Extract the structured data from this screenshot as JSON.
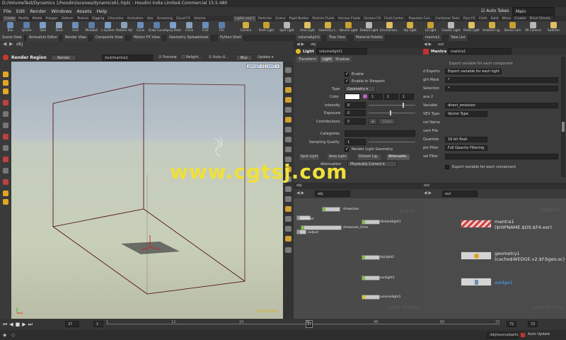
{
  "window": {
    "title": "D:/VolumeTest/Dynamics 1/houdini/scenes/dynamics61.hiplc - Houdini Indie Limited-Commercial 15.5.480"
  },
  "menu": [
    "File",
    "Edit",
    "Render",
    "Windows",
    "Assets",
    "Help"
  ],
  "workspace": {
    "auto_takes": "Auto Takes",
    "desktop": "Main"
  },
  "shelf_tabs_left": [
    "Create",
    "Modify",
    "Model",
    "Polygon",
    "Deform",
    "Texture",
    "Rigging",
    "Character",
    "Animation",
    "Hair",
    "Grooming",
    "Cloud FX",
    "Volume"
  ],
  "shelf_tabs_right": [
    "Lights and C",
    "Particles",
    "Grains",
    "Rigid Bodies",
    "Particle Fluids",
    "Viscous Fluids",
    "Oceans FX",
    "Fluid Contai..",
    "Populate Con..",
    "Container Tools",
    "Pyro FX",
    "Cloth",
    "Solid",
    "Wires",
    "Crowds",
    "Drive Simula.."
  ],
  "shelf_tools_left": [
    "Box",
    "Sphere",
    "Tube",
    "Torus",
    "Grid",
    "Metaball",
    "L-System",
    "Platonic Sol..",
    "Curve",
    "Draw Curve",
    "Spray Paint",
    "Circle",
    "Font",
    "File"
  ],
  "shelf_tools_right": [
    "Camera",
    "Point Light",
    "Spot Light",
    "Area Light",
    "Geometry L..",
    "Volume Light",
    "Distant Light",
    "Environmen..",
    "Sky Light",
    "GI Light",
    "Caustic Light",
    "Portal Light",
    "Ambient Lig..",
    "Stereo Cam",
    "VR Camera",
    "Switcher"
  ],
  "pane_tabs": [
    "Scene View",
    "Animation Editor",
    "Render View",
    "Composite View",
    "Motion FX View",
    "Geometry Spreadsheet",
    "Python Shell",
    "volumelight1",
    "Tree View",
    "Material Palette",
    "mantra1",
    "Take List"
  ],
  "viewport": {
    "title": "Render Region",
    "render_btn": "Render",
    "path": "/out/mantra1",
    "preview": "Preview",
    "relight": "Relight...",
    "auto_update": "Auto-U...",
    "blur": "Blur",
    "update": "Update",
    "obj": "obj",
    "persp": "persp1 ▾",
    "cam": "cam1 ▾",
    "edition": "Indie Edition"
  },
  "light": {
    "type_label": "Light",
    "name": "volumelight1",
    "tabs": [
      "Transform",
      "Light",
      "Shadow"
    ],
    "enable": "Enable",
    "enable_viewport": "Enable In Viewport",
    "type": "Type",
    "type_value": "Geometry",
    "color": "Color",
    "color_vals": [
      "1",
      "1",
      "1"
    ],
    "intensity": "Intensity",
    "intensity_val": "8",
    "exposure": "Exposure",
    "exposure_val": "0",
    "contributions": "Contributions",
    "contributions_val": "0",
    "clear": "Clear",
    "categories": "Categories",
    "sampling": "Sampling Quality",
    "sampling_val": "1",
    "render_geo": "Render Light Geometry",
    "subtabs": [
      "Spot Light",
      "Area Light",
      "Distant Lig..",
      "Attenuatio.."
    ],
    "attenuation": "Attenuation",
    "physically": "Physically Correct"
  },
  "mantra": {
    "label": "Mantra",
    "name": "mantra1",
    "header_note": "Export variable for each component",
    "rows": [
      {
        "label": "d Exports",
        "value": "Export variable for each light"
      },
      {
        "label": "ght Mask",
        "value": "*"
      },
      {
        "label": "Selection",
        "value": "*"
      },
      {
        "label": "ane 2",
        "value": ""
      },
      {
        "label": "Variable",
        "value": "direct_emission"
      },
      {
        "label": "VEX Type",
        "value": "Vector Type"
      },
      {
        "label": "nel Name",
        "value": ""
      },
      {
        "label": "vent File",
        "value": ""
      },
      {
        "label": "Quantize",
        "value": "16 bit float"
      },
      {
        "label": "ple Filter",
        "value": "Full Opacity Filtering"
      },
      {
        "label": "xel Filter",
        "value": ""
      }
    ],
    "footer_note": "Export variable for each component"
  },
  "netA": {
    "path": "obj",
    "context": "Scene",
    "edition": "Indie Edition",
    "nodes": [
      {
        "name": "showcase"
      },
      {
        "name": "skyrloder"
      },
      {
        "name": "dilstantlight1"
      },
      {
        "name": "showcase_hires"
      },
      {
        "name": "output"
      },
      {
        "name": "skylight1"
      },
      {
        "name": "sunlight1"
      },
      {
        "name": "volumelight1"
      }
    ]
  },
  "netB": {
    "path": "out",
    "context": "Outputs",
    "edition": "Indie Edition",
    "nodes": [
      {
        "name": "mantra1",
        "sub": "($HIPNAME.$OS.$F4.exr)"
      },
      {
        "name": "geometry1",
        "sub": "(cache$WEDGE.v2.$F.bgeo.sc)"
      },
      {
        "name": "wedge1",
        "sub": ""
      }
    ]
  },
  "timeline": {
    "frame": "37",
    "start": "1",
    "end": "1",
    "end2": "72",
    "end3": "72",
    "ticks": [
      "1",
      "12",
      "24",
      "36",
      "48",
      "60",
      "72"
    ],
    "current": "37"
  },
  "status": {
    "path": "/obj/source/parts",
    "auto_update": "Auto Update"
  },
  "watermark": "www.cgtsj.com"
}
